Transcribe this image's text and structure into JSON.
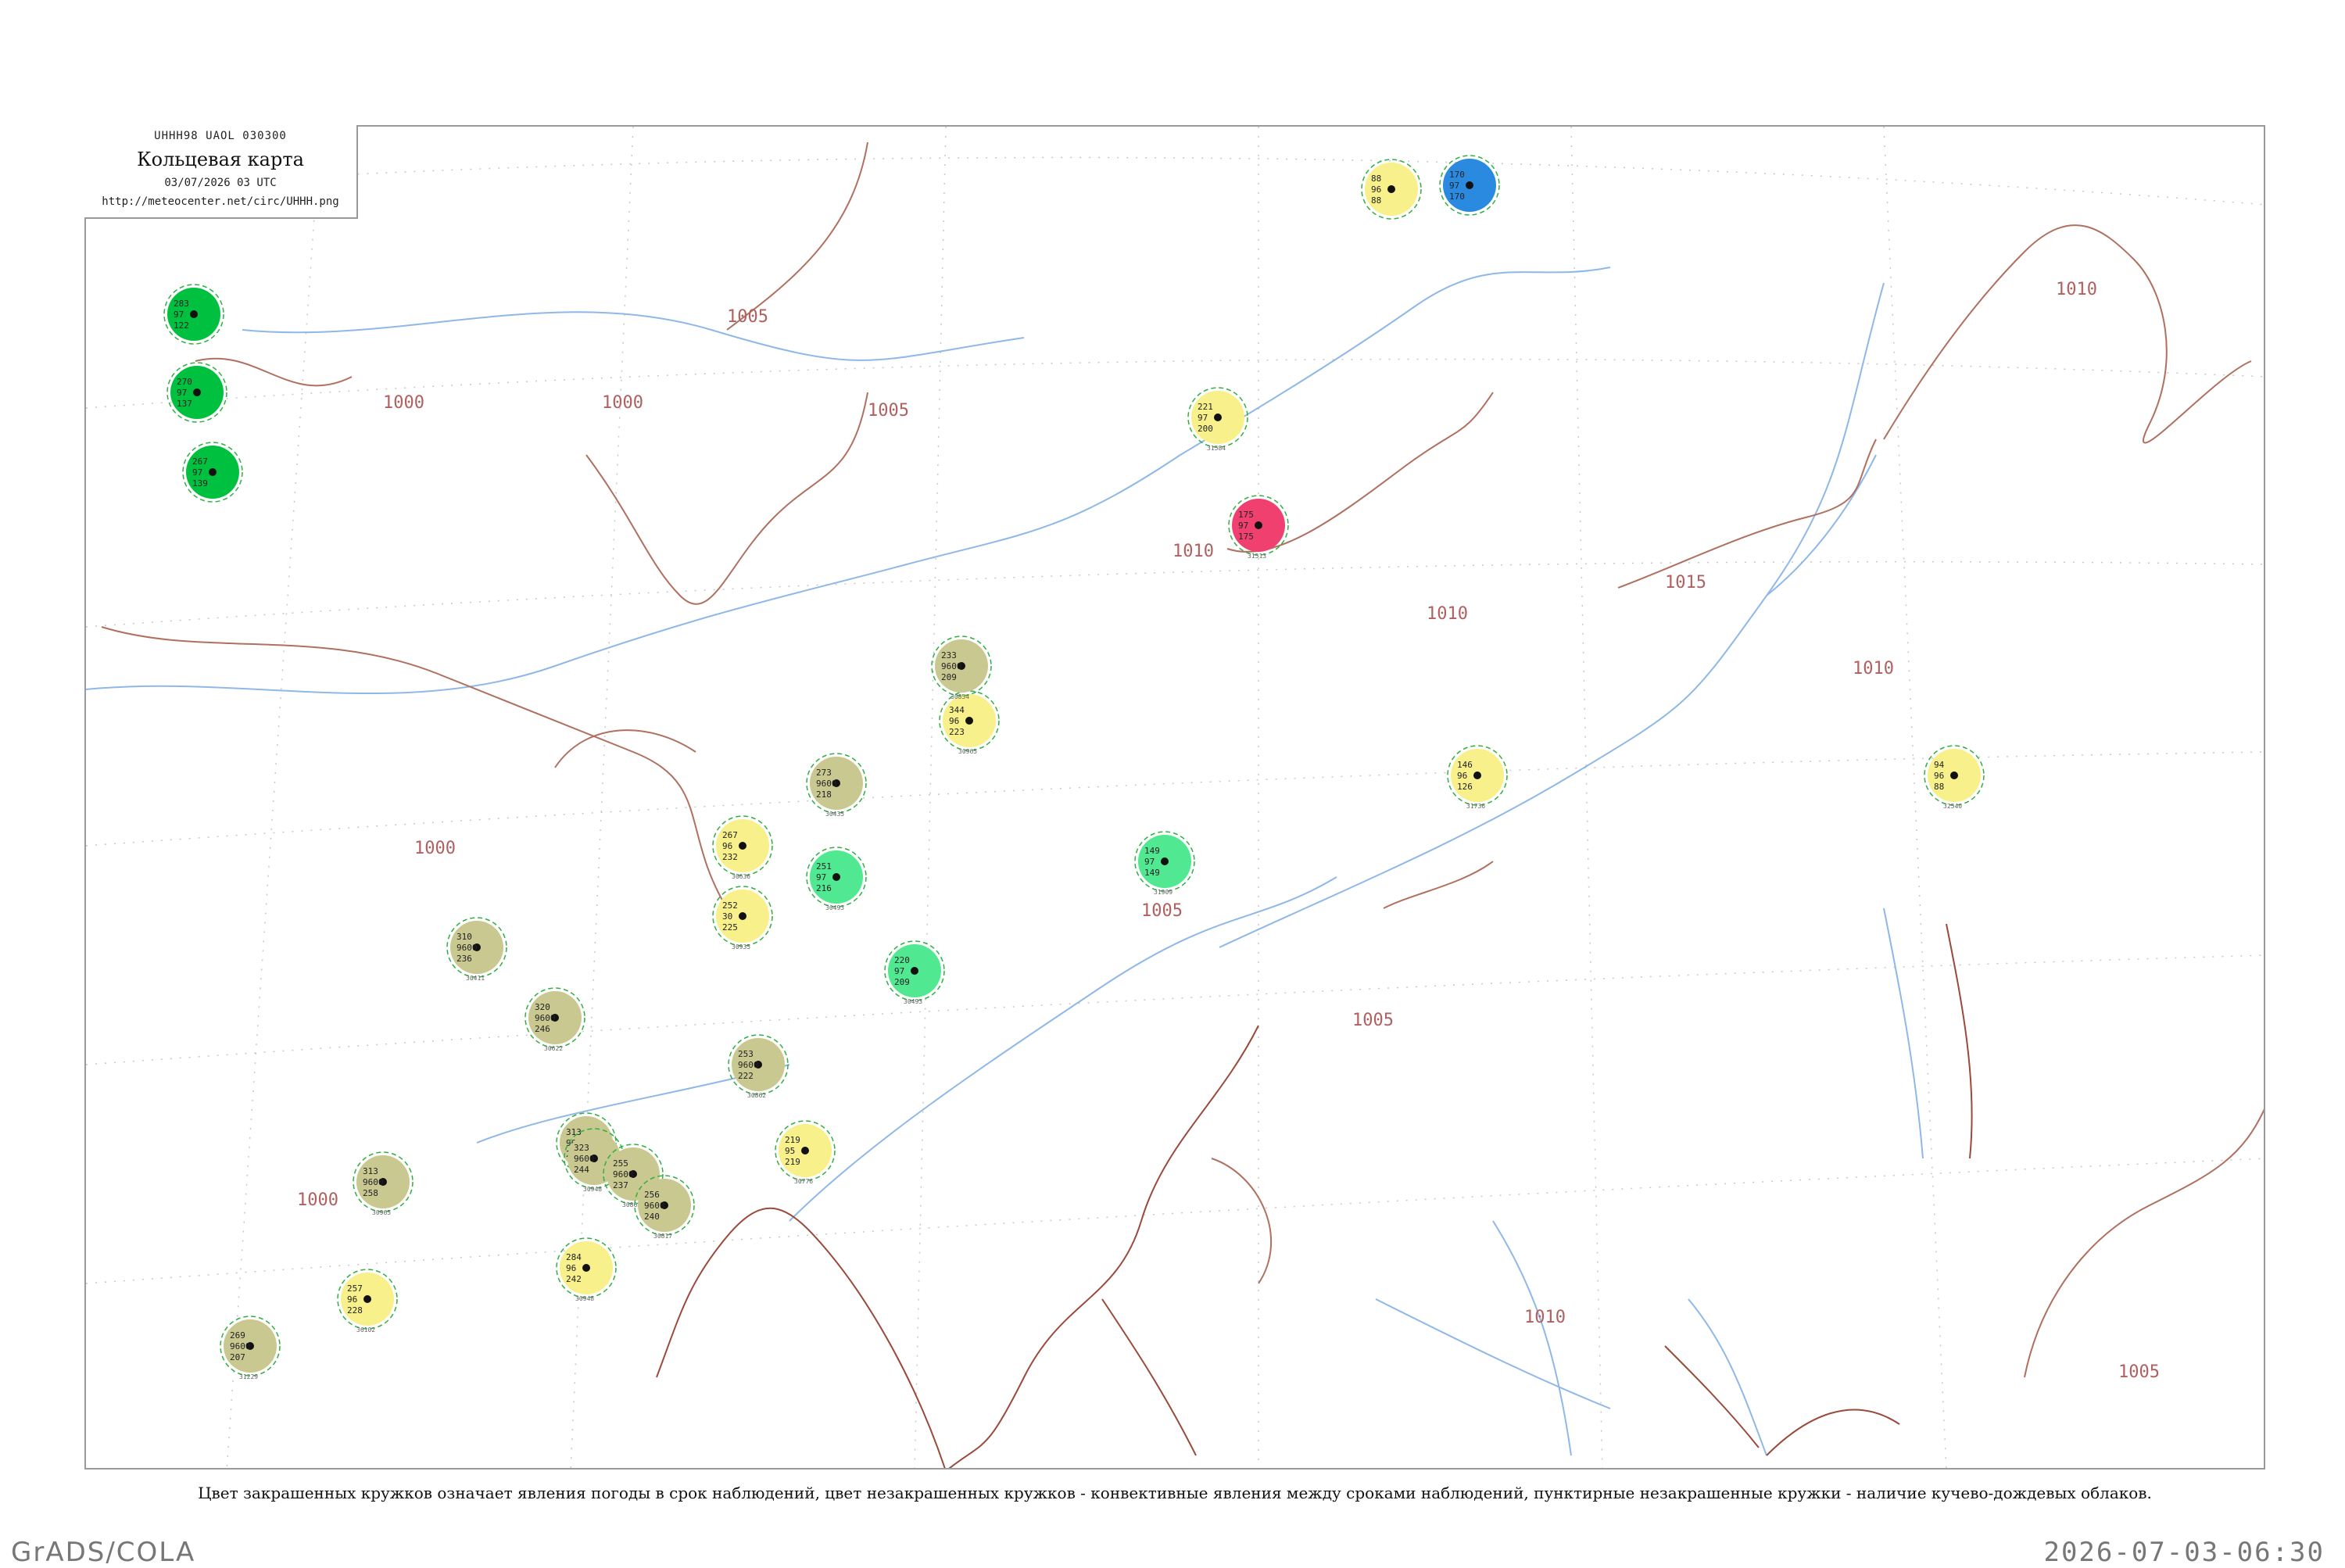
{
  "header": {
    "code": "UHHH98  UAOL  030300",
    "title": "Кольцевая карта",
    "datetime": "03/07/2026 03 UTC",
    "url": "http://meteocenter.net/circ/UHHH.png"
  },
  "legend": {
    "text": "Цвет закрашенных кружков означает явления погоды в срок наблюдений, цвет незакрашенных кружков - конвективные явления между сроками наблюдений, пунктирные незакрашенные кружки - наличие кучево-дождевых облаков."
  },
  "footer": {
    "left": "GrADS/COLA",
    "right": "2026-07-03-06:30"
  },
  "colors": {
    "isobar": "#b07060",
    "coast": "#9a4a3a",
    "river": "#8fb8e8",
    "rain": "#00c040",
    "fog": "#f8f08a",
    "haze": "#c8c890",
    "shower": "#50e890",
    "thunder": "#f04070",
    "snow": "#2a8ae0",
    "cb_dashed": "#30b040"
  },
  "isobar_labels": [
    "1000",
    "1005",
    "1000",
    "1000",
    "1000",
    "1005",
    "1010",
    "1015",
    "1010",
    "1005",
    "1005",
    "1010",
    "1010",
    "1010",
    "1005"
  ],
  "stations": [
    {
      "p": "283",
      "t": "97",
      "d": "122",
      "id": "",
      "c": "rain"
    },
    {
      "p": "270",
      "t": "97",
      "d": "137",
      "id": "",
      "c": "rain"
    },
    {
      "p": "267",
      "t": "97",
      "d": "139",
      "id": "",
      "c": "rain"
    },
    {
      "p": "221",
      "t": "97",
      "d": "200",
      "id": "31584",
      "c": "fog"
    },
    {
      "p": "344",
      "t": "96",
      "d": "223",
      "id": "30965",
      "c": "fog"
    },
    {
      "p": "267",
      "t": "96",
      "d": "232",
      "id": "30636",
      "c": "fog"
    },
    {
      "p": "252",
      "t": "30",
      "d": "225",
      "id": "30935",
      "c": "fog"
    },
    {
      "p": "219",
      "t": "95",
      "d": "219",
      "id": "30776",
      "c": "fog"
    },
    {
      "p": "257",
      "t": "96",
      "d": "228",
      "id": "36102",
      "c": "fog"
    },
    {
      "p": "284",
      "t": "96",
      "d": "242",
      "id": "30948",
      "c": "fog"
    },
    {
      "p": "146",
      "t": "96",
      "d": "126",
      "id": "31736",
      "c": "fog"
    },
    {
      "p": "94",
      "t": "96",
      "d": "88",
      "id": "32540",
      "c": "fog"
    },
    {
      "p": "88",
      "t": "96",
      "d": "88",
      "id": "",
      "c": "fog"
    },
    {
      "p": "233",
      "t": "9600",
      "d": "209",
      "id": "30854",
      "c": "haze"
    },
    {
      "p": "273",
      "t": "9600",
      "d": "218",
      "id": "30435",
      "c": "haze"
    },
    {
      "p": "310",
      "t": "9600",
      "d": "236",
      "id": "30411",
      "c": "haze"
    },
    {
      "p": "320",
      "t": "9600",
      "d": "246",
      "id": "30622",
      "c": "haze"
    },
    {
      "p": "253",
      "t": "9600",
      "d": "222",
      "id": "30862",
      "c": "haze"
    },
    {
      "p": "313",
      "t": "9600",
      "d": "247",
      "id": "",
      "c": "haze"
    },
    {
      "p": "313",
      "t": "9600",
      "d": "258",
      "id": "30965",
      "c": "haze"
    },
    {
      "p": "323",
      "t": "9600",
      "d": "244",
      "id": "30948",
      "c": "haze"
    },
    {
      "p": "255",
      "t": "9600",
      "d": "237",
      "id": "30863",
      "c": "haze"
    },
    {
      "p": "256",
      "t": "9600",
      "d": "240",
      "id": "30817",
      "c": "haze"
    },
    {
      "p": "269",
      "t": "9600",
      "d": "207",
      "id": "31229",
      "c": "haze"
    },
    {
      "p": "251",
      "t": "97",
      "d": "216",
      "id": "30493",
      "c": "shower"
    },
    {
      "p": "220",
      "t": "97",
      "d": "209",
      "id": "30493",
      "c": "shower"
    },
    {
      "p": "149",
      "t": "97",
      "d": "149",
      "id": "31909",
      "c": "shower"
    },
    {
      "p": "175",
      "t": "97",
      "d": "175",
      "id": "31513",
      "c": "thunder"
    },
    {
      "p": "170",
      "t": "97",
      "d": "170",
      "id": "",
      "c": "snow"
    }
  ]
}
